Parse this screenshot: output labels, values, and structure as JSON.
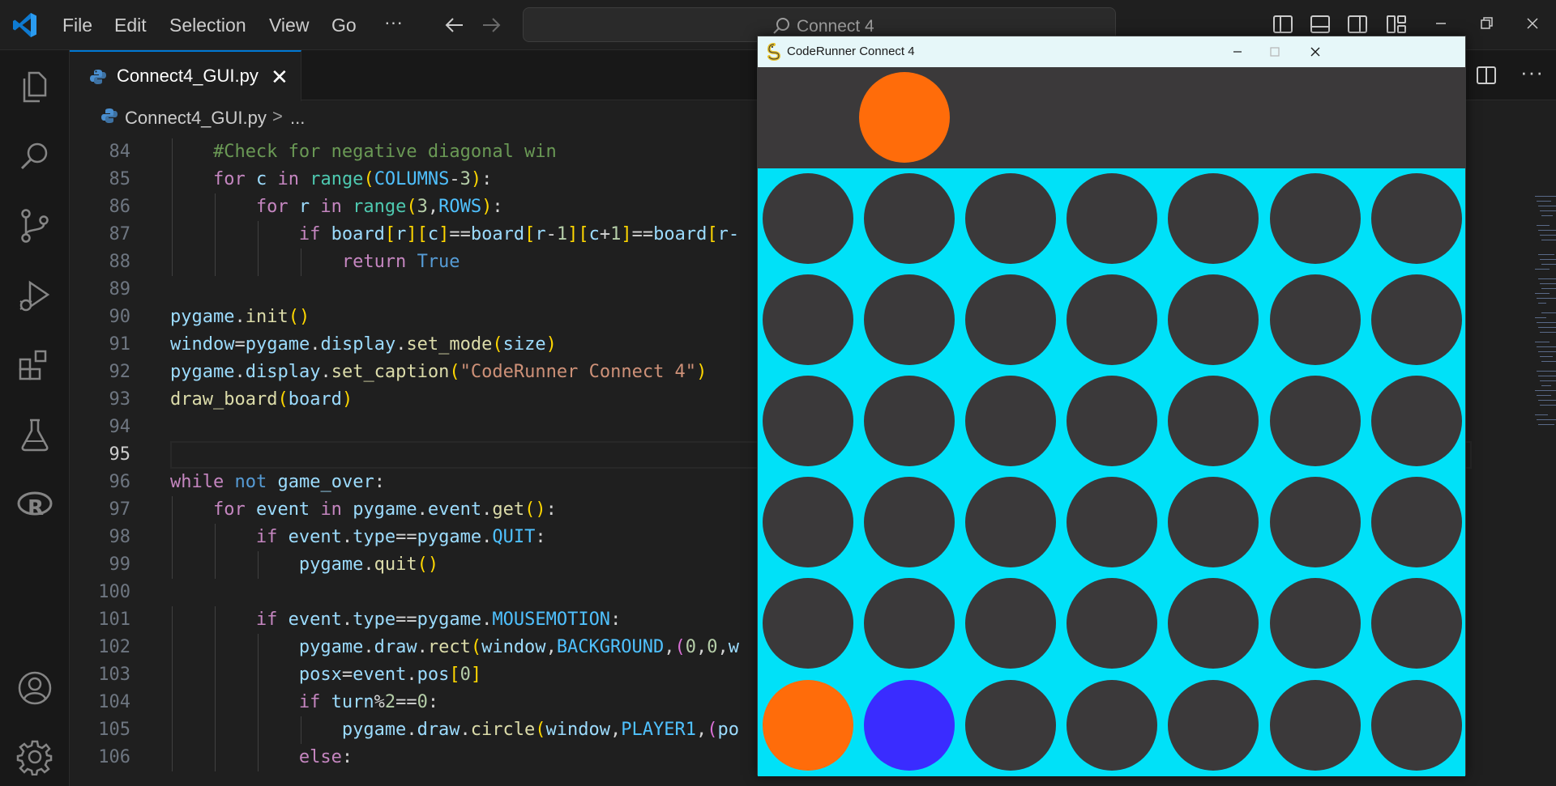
{
  "menu": [
    "File",
    "Edit",
    "Selection",
    "View",
    "Go",
    "···"
  ],
  "command_center": {
    "text": "Connect 4"
  },
  "tab": {
    "label": "Connect4_GUI.py",
    "close": "✕"
  },
  "breadcrumb": {
    "file": "Connect4_GUI.py",
    "separator": ">",
    "more": "..."
  },
  "editor": {
    "current_line": 95,
    "lines": [
      {
        "n": "84",
        "indent": 1,
        "tokens": [
          [
            "cm",
            "#Check for negative diagonal win"
          ]
        ]
      },
      {
        "n": "85",
        "indent": 1,
        "tokens": [
          [
            "kw",
            "for"
          ],
          [
            "op",
            " "
          ],
          [
            "vr",
            "c"
          ],
          [
            "op",
            " "
          ],
          [
            "kw",
            "in"
          ],
          [
            "op",
            " "
          ],
          [
            "cl",
            "range"
          ],
          [
            "b1",
            "("
          ],
          [
            "cn",
            "COLUMNS"
          ],
          [
            "op",
            "-"
          ],
          [
            "nm",
            "3"
          ],
          [
            "b1",
            ")"
          ],
          [
            "op",
            ":"
          ]
        ]
      },
      {
        "n": "86",
        "indent": 2,
        "tokens": [
          [
            "kw",
            "for"
          ],
          [
            "op",
            " "
          ],
          [
            "vr",
            "r"
          ],
          [
            "op",
            " "
          ],
          [
            "kw",
            "in"
          ],
          [
            "op",
            " "
          ],
          [
            "cl",
            "range"
          ],
          [
            "b1",
            "("
          ],
          [
            "nm",
            "3"
          ],
          [
            "op",
            ","
          ],
          [
            "cn",
            "ROWS"
          ],
          [
            "b1",
            ")"
          ],
          [
            "op",
            ":"
          ]
        ]
      },
      {
        "n": "87",
        "indent": 3,
        "tokens": [
          [
            "kw",
            "if"
          ],
          [
            "op",
            " "
          ],
          [
            "vr",
            "board"
          ],
          [
            "b1",
            "["
          ],
          [
            "vr",
            "r"
          ],
          [
            "b1",
            "]"
          ],
          [
            "b1",
            "["
          ],
          [
            "vr",
            "c"
          ],
          [
            "b1",
            "]"
          ],
          [
            "op",
            "=="
          ],
          [
            "vr",
            "board"
          ],
          [
            "b1",
            "["
          ],
          [
            "vr",
            "r"
          ],
          [
            "op",
            "-"
          ],
          [
            "nm",
            "1"
          ],
          [
            "b1",
            "]"
          ],
          [
            "b1",
            "["
          ],
          [
            "vr",
            "c"
          ],
          [
            "op",
            "+"
          ],
          [
            "nm",
            "1"
          ],
          [
            "b1",
            "]"
          ],
          [
            "op",
            "=="
          ],
          [
            "vr",
            "board"
          ],
          [
            "b1",
            "["
          ],
          [
            "vr",
            "r-"
          ]
        ]
      },
      {
        "n": "88",
        "indent": 4,
        "tokens": [
          [
            "kw",
            "return"
          ],
          [
            "op",
            " "
          ],
          [
            "bl",
            "True"
          ]
        ]
      },
      {
        "n": "89",
        "indent": 0,
        "tokens": []
      },
      {
        "n": "90",
        "indent": 0,
        "tokens": [
          [
            "vr",
            "pygame"
          ],
          [
            "op",
            "."
          ],
          [
            "fn",
            "init"
          ],
          [
            "b1",
            "()"
          ]
        ]
      },
      {
        "n": "91",
        "indent": 0,
        "tokens": [
          [
            "vr",
            "window"
          ],
          [
            "op",
            "="
          ],
          [
            "vr",
            "pygame"
          ],
          [
            "op",
            "."
          ],
          [
            "vr",
            "display"
          ],
          [
            "op",
            "."
          ],
          [
            "fn",
            "set_mode"
          ],
          [
            "b1",
            "("
          ],
          [
            "vr",
            "size"
          ],
          [
            "b1",
            ")"
          ]
        ]
      },
      {
        "n": "92",
        "indent": 0,
        "tokens": [
          [
            "vr",
            "pygame"
          ],
          [
            "op",
            "."
          ],
          [
            "vr",
            "display"
          ],
          [
            "op",
            "."
          ],
          [
            "fn",
            "set_caption"
          ],
          [
            "b1",
            "("
          ],
          [
            "st",
            "\"CodeRunner Connect 4\""
          ],
          [
            "b1",
            ")"
          ]
        ]
      },
      {
        "n": "93",
        "indent": 0,
        "tokens": [
          [
            "fn",
            "draw_board"
          ],
          [
            "b1",
            "("
          ],
          [
            "vr",
            "board"
          ],
          [
            "b1",
            ")"
          ]
        ]
      },
      {
        "n": "94",
        "indent": 0,
        "tokens": []
      },
      {
        "n": "95",
        "indent": 0,
        "tokens": []
      },
      {
        "n": "96",
        "indent": 0,
        "tokens": [
          [
            "kw",
            "while"
          ],
          [
            "op",
            " "
          ],
          [
            "bl",
            "not"
          ],
          [
            "op",
            " "
          ],
          [
            "vr",
            "game_over"
          ],
          [
            "op",
            ":"
          ]
        ]
      },
      {
        "n": "97",
        "indent": 1,
        "tokens": [
          [
            "kw",
            "for"
          ],
          [
            "op",
            " "
          ],
          [
            "vr",
            "event"
          ],
          [
            "op",
            " "
          ],
          [
            "kw",
            "in"
          ],
          [
            "op",
            " "
          ],
          [
            "vr",
            "pygame"
          ],
          [
            "op",
            "."
          ],
          [
            "vr",
            "event"
          ],
          [
            "op",
            "."
          ],
          [
            "fn",
            "get"
          ],
          [
            "b1",
            "()"
          ],
          [
            "op",
            ":"
          ]
        ]
      },
      {
        "n": "98",
        "indent": 2,
        "tokens": [
          [
            "kw",
            "if"
          ],
          [
            "op",
            " "
          ],
          [
            "vr",
            "event"
          ],
          [
            "op",
            "."
          ],
          [
            "vr",
            "type"
          ],
          [
            "op",
            "=="
          ],
          [
            "vr",
            "pygame"
          ],
          [
            "op",
            "."
          ],
          [
            "cn",
            "QUIT"
          ],
          [
            "op",
            ":"
          ]
        ]
      },
      {
        "n": "99",
        "indent": 3,
        "tokens": [
          [
            "vr",
            "pygame"
          ],
          [
            "op",
            "."
          ],
          [
            "fn",
            "quit"
          ],
          [
            "b1",
            "()"
          ]
        ]
      },
      {
        "n": "100",
        "indent": 0,
        "tokens": []
      },
      {
        "n": "101",
        "indent": 2,
        "tokens": [
          [
            "kw",
            "if"
          ],
          [
            "op",
            " "
          ],
          [
            "vr",
            "event"
          ],
          [
            "op",
            "."
          ],
          [
            "vr",
            "type"
          ],
          [
            "op",
            "=="
          ],
          [
            "vr",
            "pygame"
          ],
          [
            "op",
            "."
          ],
          [
            "cn",
            "MOUSEMOTION"
          ],
          [
            "op",
            ":"
          ]
        ]
      },
      {
        "n": "102",
        "indent": 3,
        "tokens": [
          [
            "vr",
            "pygame"
          ],
          [
            "op",
            "."
          ],
          [
            "vr",
            "draw"
          ],
          [
            "op",
            "."
          ],
          [
            "fn",
            "rect"
          ],
          [
            "b1",
            "("
          ],
          [
            "vr",
            "window"
          ],
          [
            "op",
            ","
          ],
          [
            "cn",
            "BACKGROUND"
          ],
          [
            "op",
            ","
          ],
          [
            "b2",
            "("
          ],
          [
            "nm",
            "0"
          ],
          [
            "op",
            ","
          ],
          [
            "nm",
            "0"
          ],
          [
            "op",
            ","
          ],
          [
            "vr",
            "w"
          ]
        ]
      },
      {
        "n": "103",
        "indent": 3,
        "tokens": [
          [
            "vr",
            "posx"
          ],
          [
            "op",
            "="
          ],
          [
            "vr",
            "event"
          ],
          [
            "op",
            "."
          ],
          [
            "vr",
            "pos"
          ],
          [
            "b1",
            "["
          ],
          [
            "nm",
            "0"
          ],
          [
            "b1",
            "]"
          ]
        ]
      },
      {
        "n": "104",
        "indent": 3,
        "tokens": [
          [
            "kw",
            "if"
          ],
          [
            "op",
            " "
          ],
          [
            "vr",
            "turn"
          ],
          [
            "op",
            "%"
          ],
          [
            "nm",
            "2"
          ],
          [
            "op",
            "=="
          ],
          [
            "nm",
            "0"
          ],
          [
            "op",
            ":"
          ]
        ]
      },
      {
        "n": "105",
        "indent": 4,
        "tokens": [
          [
            "vr",
            "pygame"
          ],
          [
            "op",
            "."
          ],
          [
            "vr",
            "draw"
          ],
          [
            "op",
            "."
          ],
          [
            "fn",
            "circle"
          ],
          [
            "b1",
            "("
          ],
          [
            "vr",
            "window"
          ],
          [
            "op",
            ","
          ],
          [
            "cn",
            "PLAYER1"
          ],
          [
            "op",
            ","
          ],
          [
            "b2",
            "("
          ],
          [
            "vr",
            "po"
          ]
        ]
      },
      {
        "n": "106",
        "indent": 3,
        "tokens": [
          [
            "kw",
            "else"
          ],
          [
            "op",
            ":"
          ]
        ]
      }
    ]
  },
  "game_window": {
    "title": "CodeRunner Connect 4",
    "hover_column": 1,
    "colors": {
      "board": "#00e1f8",
      "empty": "#3b393a",
      "player1": "#ff6c0a",
      "player2": "#3a2cff",
      "background": "#3b393a"
    },
    "rows": 6,
    "columns": 7,
    "grid": [
      [
        "empty",
        "empty",
        "empty",
        "empty",
        "empty",
        "empty",
        "empty"
      ],
      [
        "empty",
        "empty",
        "empty",
        "empty",
        "empty",
        "empty",
        "empty"
      ],
      [
        "empty",
        "empty",
        "empty",
        "empty",
        "empty",
        "empty",
        "empty"
      ],
      [
        "empty",
        "empty",
        "empty",
        "empty",
        "empty",
        "empty",
        "empty"
      ],
      [
        "empty",
        "empty",
        "empty",
        "empty",
        "empty",
        "empty",
        "empty"
      ],
      [
        "player1",
        "player2",
        "empty",
        "empty",
        "empty",
        "empty",
        "empty"
      ]
    ]
  }
}
